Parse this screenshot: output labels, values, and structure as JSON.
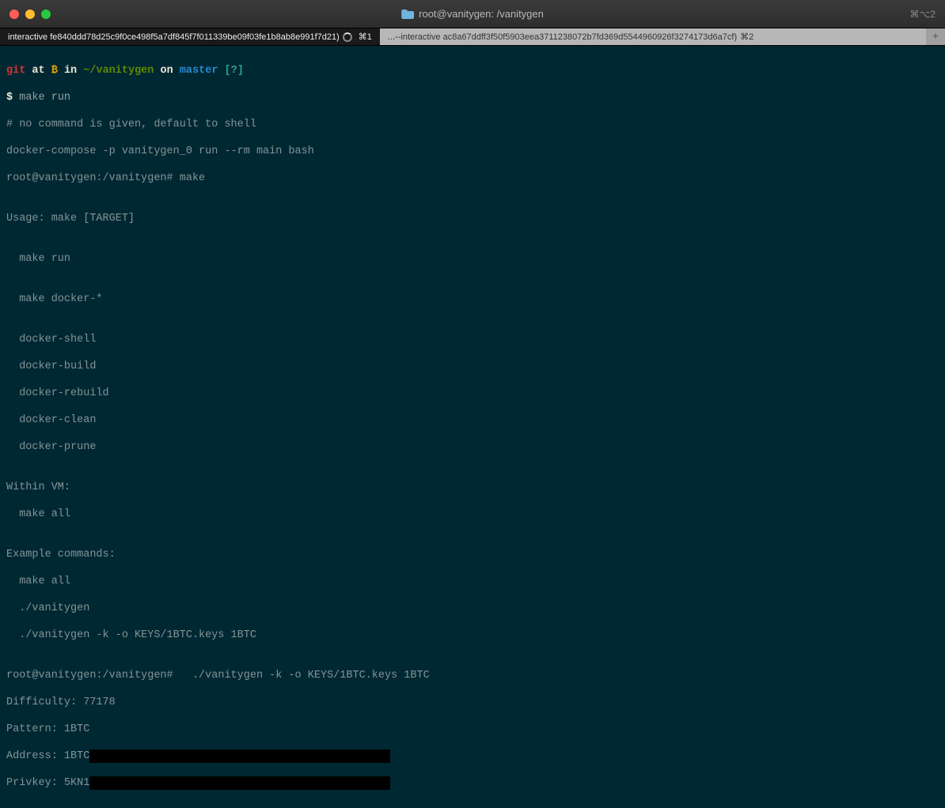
{
  "titlebar": {
    "title": "root@vanitygen: /vanitygen",
    "right_indicator": "⌘⌥2"
  },
  "tabs": {
    "active": {
      "label": "interactive fe840ddd78d25c9f0ce498f5a7df845f7f011339be09f03fe1b8ab8e991f7d21)",
      "kbd": "⌘1"
    },
    "inactive": {
      "label": "...--interactive ac8a67ddff3f50f5903eea3711238072b7fd369d5544960926f3274173d6a7cf)",
      "kbd": "⌘2"
    }
  },
  "prompt": {
    "git": "git",
    "at": "at",
    "btc": "₿",
    "in": "in",
    "path": "~/vanitygen",
    "on": "on",
    "branch": "master",
    "status": "[?]",
    "dollar": "$",
    "cmd_make_run": "make run"
  },
  "lines": {
    "no_command": "# no command is given, default to shell",
    "docker_compose": "docker-compose -p vanitygen_0 run --rm main bash",
    "root_make": "root@vanitygen:/vanitygen# make",
    "blank": "",
    "usage": "Usage: make [TARGET]",
    "make_run": "  make run",
    "make_docker": "  make docker-*",
    "docker_shell": "  docker-shell",
    "docker_build": "  docker-build",
    "docker_rebuild": "  docker-rebuild",
    "docker_clean": "  docker-clean",
    "docker_prune": "  docker-prune",
    "within_vm": "Within VM:",
    "make_all1": "  make all",
    "example": "Example commands:",
    "make_all2": "  make all",
    "vanitygen1": "  ./vanitygen",
    "vanitygen2": "  ./vanitygen -k -o KEYS/1BTC.keys 1BTC",
    "root_vanitygen": "root@vanitygen:/vanitygen#   ./vanitygen -k -o KEYS/1BTC.keys 1BTC",
    "difficulty": "Difficulty: 77178",
    "pattern": "Pattern: 1BTC",
    "address": "Address: 1BTC",
    "privkey": "Privkey: 5KN1"
  }
}
